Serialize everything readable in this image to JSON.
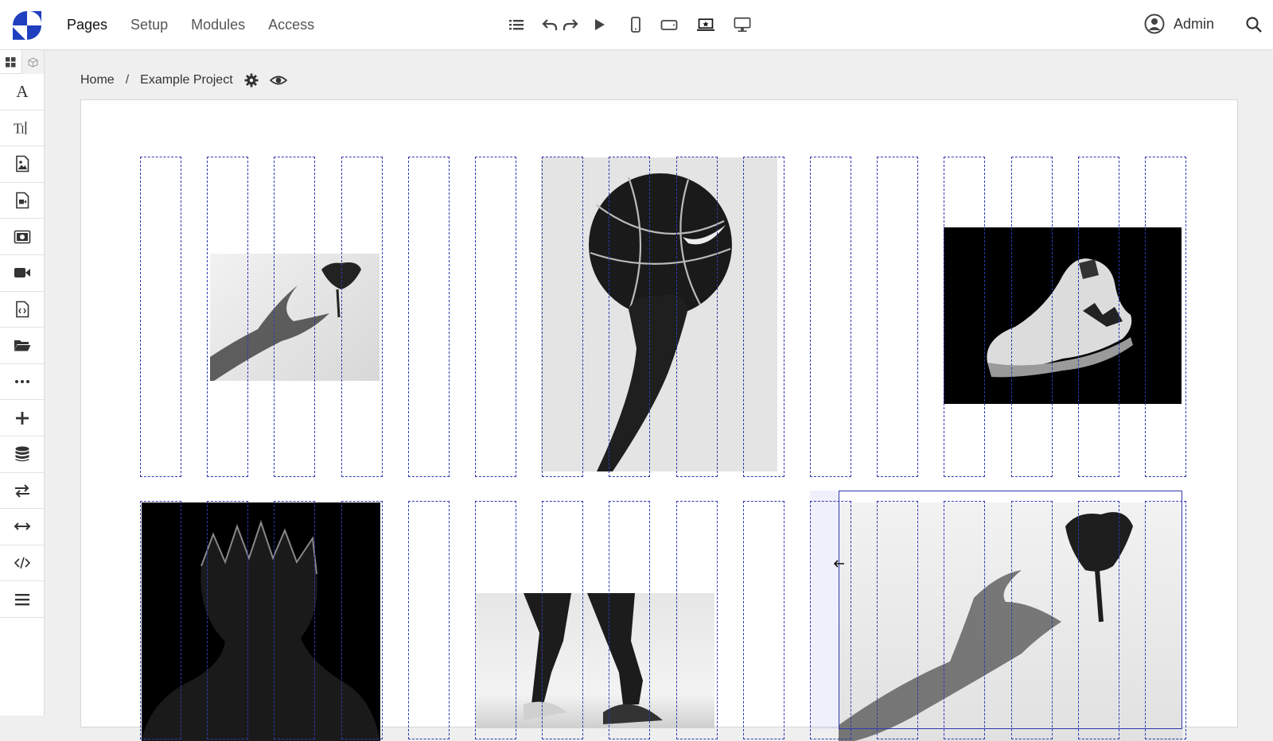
{
  "nav": {
    "items": [
      {
        "label": "Pages",
        "active": true
      },
      {
        "label": "Setup",
        "active": false
      },
      {
        "label": "Modules",
        "active": false
      },
      {
        "label": "Access",
        "active": false
      }
    ]
  },
  "toolbar": {
    "icons": [
      "list-icon",
      "undo-icon",
      "redo-icon",
      "play-icon",
      "phone-view-icon",
      "tablet-view-icon",
      "laptop-view-icon",
      "desktop-view-icon"
    ],
    "active_view": "laptop-view"
  },
  "user": {
    "name": "Admin"
  },
  "sidebar": {
    "tabs": [
      "grid-icon",
      "cube-icon"
    ],
    "tools": [
      "font-icon",
      "text-block-icon",
      "image-file-icon",
      "video-file-icon",
      "photo-icon",
      "video-camera-icon",
      "code-file-icon",
      "folder-icon",
      "more-icon",
      "add-icon",
      "database-icon",
      "swap-icon",
      "resize-horizontal-icon",
      "code-icon",
      "menu-icon"
    ]
  },
  "breadcrumb": {
    "home": "Home",
    "separator": "/",
    "project": "Example Project"
  },
  "colors": {
    "guide": "#3038b0",
    "accent": "#1f3fbf"
  }
}
